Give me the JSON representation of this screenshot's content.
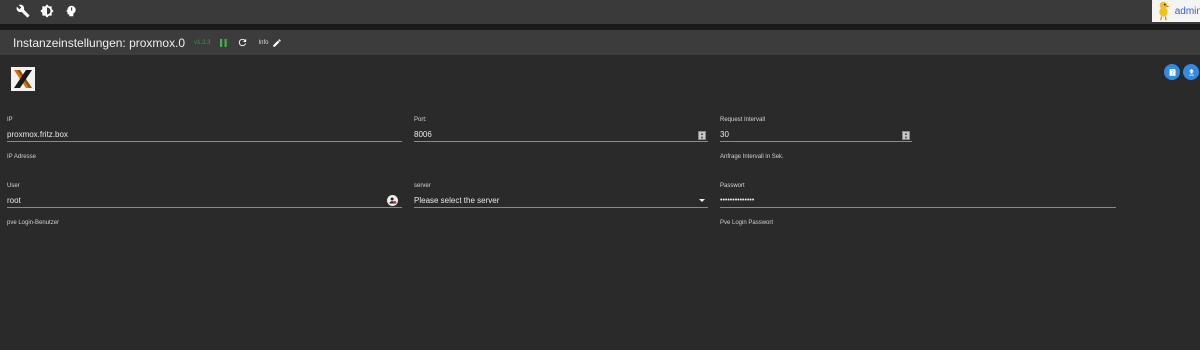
{
  "header": {
    "user_name": "admin"
  },
  "titlebar": {
    "title": "Instanzeinstellungen: proxmox.0",
    "version": "v1.3.3",
    "info_label": "Info"
  },
  "form": {
    "ip": {
      "label": "IP",
      "value": "proxmox.fritz.box",
      "helper": "IP Adresse"
    },
    "port": {
      "label": "Port:",
      "value": "8006"
    },
    "interval": {
      "label": "Request Intervall",
      "value": "30",
      "helper": "Anfrage Intervall in Sek."
    },
    "user": {
      "label": "User",
      "value": "root",
      "helper": "pve Login-Benutzer"
    },
    "server": {
      "label": "server",
      "value": "Please select the server"
    },
    "password": {
      "label": "Passwort",
      "value": "••••••••••••••",
      "helper": "Pve Login Passwort"
    }
  },
  "colors": {
    "accent": "#2f8be6",
    "version": "#3b9a4a",
    "pause": "#3fb24e"
  }
}
